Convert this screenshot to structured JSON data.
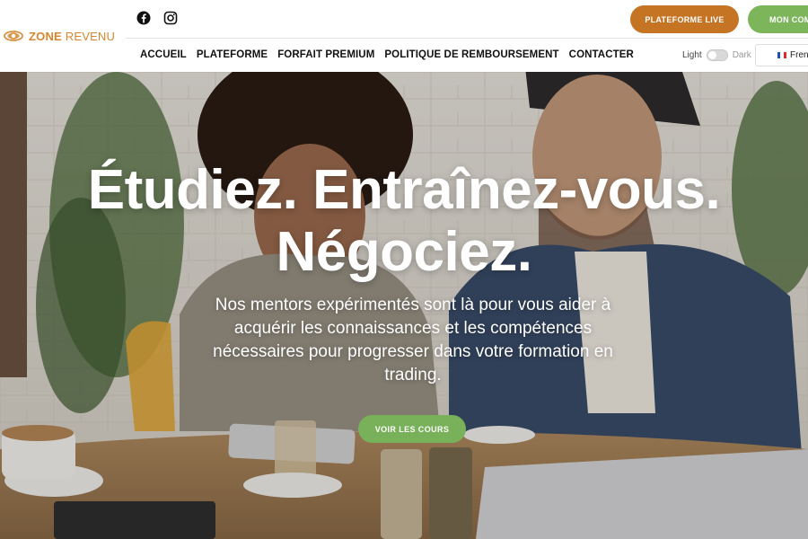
{
  "brand": {
    "name_bold": "ZONE",
    "name_rest": " REVENU"
  },
  "social": {
    "icons": [
      "facebook-icon",
      "instagram-icon"
    ]
  },
  "header": {
    "platform_live_label": "PLATEFORME LIVE",
    "account_label": "MON COMPTE"
  },
  "nav": {
    "items": [
      {
        "label": "ACCUEIL"
      },
      {
        "label": "PLATEFORME"
      },
      {
        "label": "FORFAIT PREMIUM"
      },
      {
        "label": "POLITIQUE DE REMBOURSEMENT"
      },
      {
        "label": "CONTACTER"
      }
    ]
  },
  "theme_toggle": {
    "light_label": "Light",
    "dark_label": "Dark"
  },
  "language": {
    "selected": "French"
  },
  "hero": {
    "title_line1": "Étudiez. Entraînez-vous.",
    "title_line2": "Négociez.",
    "subtitle": "Nos mentors expérimentés sont là pour vous aider à acquérir les connaissances et les compétences nécessaires pour progresser dans votre formation en trading.",
    "cta_label": "VOIR LES COURS"
  },
  "colors": {
    "brand_orange": "#d9852d",
    "live_button": "#c57424",
    "account_button": "#7cb55a",
    "cta_button": "#78b159"
  }
}
